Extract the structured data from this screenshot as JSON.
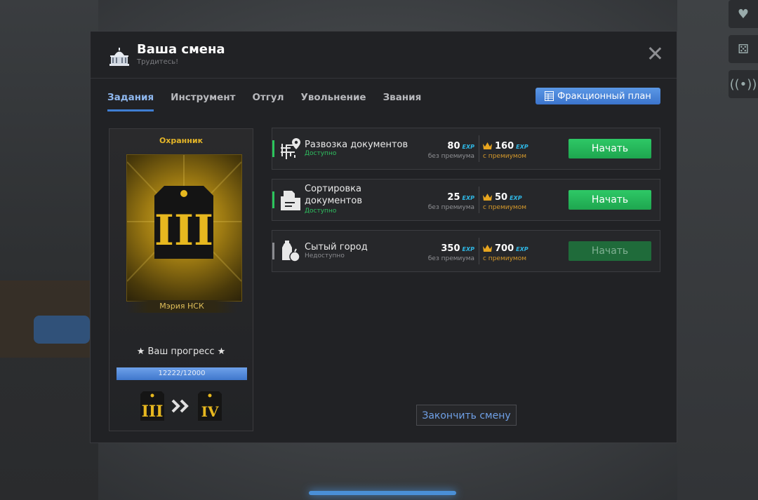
{
  "header": {
    "title": "Ваша смена",
    "subtitle": "Трудитесь!"
  },
  "tabs": [
    {
      "label": "Задания",
      "active": true
    },
    {
      "label": "Инструмент"
    },
    {
      "label": "Отгул"
    },
    {
      "label": "Увольнение"
    },
    {
      "label": "Звания"
    }
  ],
  "plan_button": "Фракционный план",
  "rank_card": {
    "role": "Охранник",
    "current_rank": "III",
    "next_rank": "IV",
    "org": "Мэрия НСК",
    "progress_label": "★ Ваш прогресс ★",
    "progress_text": "12222/12000",
    "progress_fraction": 1.0
  },
  "tasks": [
    {
      "name": "Развозка документов",
      "status": "Доступно",
      "available": true,
      "exp": "80",
      "exp_premium": "160",
      "exp_tag": "EXP",
      "exp_sub": "без премиума",
      "prem_sub": "с премиумом",
      "button": "Начать",
      "icon": "route-pin-icon"
    },
    {
      "name": "Сортировка документов",
      "status": "Доступно",
      "available": true,
      "exp": "25",
      "exp_premium": "50",
      "exp_tag": "EXP",
      "exp_sub": "без премиума",
      "prem_sub": "с премиумом",
      "button": "Начать",
      "icon": "folder-docs-icon"
    },
    {
      "name": "Сытый город",
      "status": "Недоступно",
      "available": false,
      "exp": "350",
      "exp_premium": "700",
      "exp_tag": "EXP",
      "exp_sub": "без премиума",
      "prem_sub": "с премиумом",
      "button": "Начать",
      "icon": "bottle-apple-icon"
    }
  ],
  "end_button": "Закончить смену",
  "colors": {
    "accent_blue": "#3f7ed3",
    "start_green": "#2ec866",
    "gold": "#e4b528",
    "exp_cyan": "#2fb8e6",
    "premium_orange": "#d79a2b"
  }
}
